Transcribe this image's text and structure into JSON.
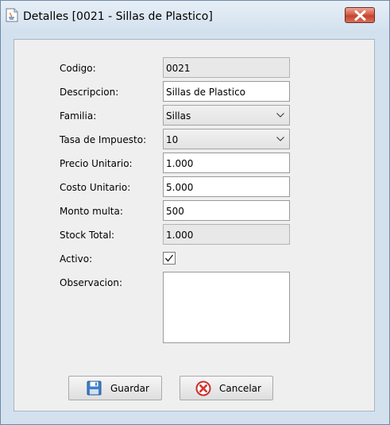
{
  "window": {
    "title": "Detalles [0021 - Sillas de Plastico]",
    "app_icon": "java-icon",
    "close_icon": "close-icon"
  },
  "form": {
    "codigo": {
      "label": "Codigo:",
      "value": "0021"
    },
    "descripcion": {
      "label": "Descripcion:",
      "value": "Sillas de Plastico"
    },
    "familia": {
      "label": "Familia:",
      "value": "Sillas"
    },
    "tasa": {
      "label": "Tasa de Impuesto:",
      "value": "10"
    },
    "precio": {
      "label": "Precio Unitario:",
      "value": "1.000"
    },
    "costo": {
      "label": "Costo Unitario:",
      "value": "5.000"
    },
    "multa": {
      "label": "Monto multa:",
      "value": "500"
    },
    "stock": {
      "label": "Stock Total:",
      "value": "1.000"
    },
    "activo": {
      "label": "Activo:",
      "checked": true
    },
    "observacion": {
      "label": "Observacion:",
      "value": ""
    }
  },
  "buttons": {
    "guardar": {
      "label": "Guardar",
      "icon": "floppy-disk-icon"
    },
    "cancelar": {
      "label": "Cancelar",
      "icon": "cancel-icon"
    }
  }
}
